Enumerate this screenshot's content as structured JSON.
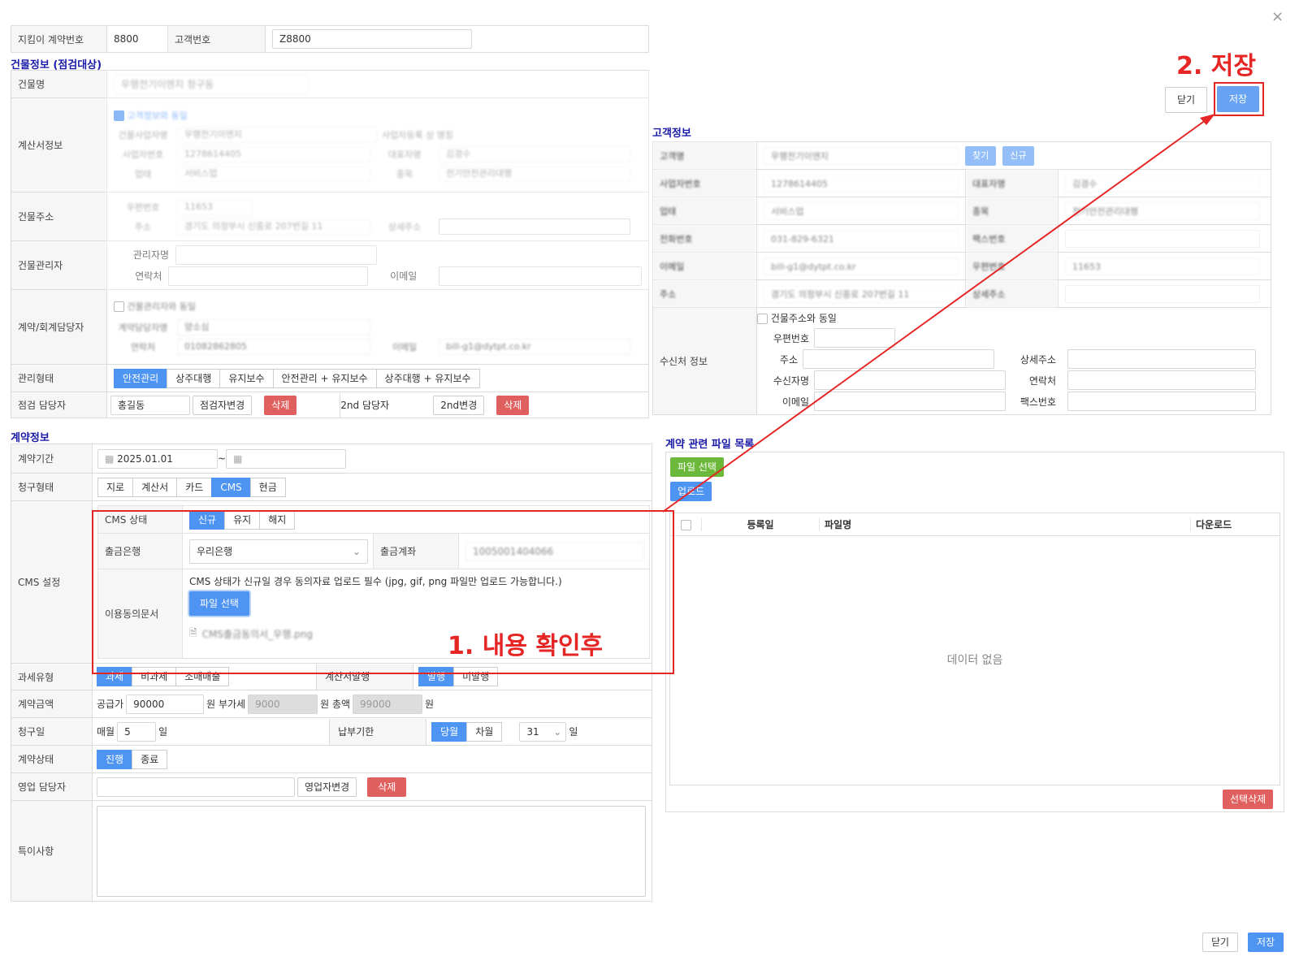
{
  "close_icon": "×",
  "contract_top": {
    "label1": "지킴이 계약번호",
    "value1": "8800",
    "label2": "고객번호",
    "value2": "Z8800"
  },
  "building_section": {
    "title": "건물정보 (점검대상)",
    "name_label": "건물명",
    "name_value": "우행전기이엔지 청구동",
    "invoice_label": "계산서정보",
    "same_as_customer": "고객정보와 동일",
    "biz_name_label": "건물사업자명",
    "biz_name_value": "우행전기이엔지",
    "biz_reg_label": "사업자등록 상 명칭",
    "biz_no_label": "사업자번호",
    "biz_no_value": "1278614405",
    "ceo_label": "대표자명",
    "ceo_value": "김경수",
    "industry_label": "업태",
    "industry_value": "서비스업",
    "item_label": "종목",
    "item_value": "전기안전관리대행",
    "address_label": "건물주소",
    "zip_label": "우편번호",
    "zip_value": "11653",
    "addr_label": "주소",
    "addr_value": "경기도 의정부시 신흥로 207번길 11",
    "detail_label": "상세주소",
    "manager_label": "건물관리자",
    "manager_name_label": "관리자명",
    "manager_phone_label": "연락처",
    "manager_email_label": "이메일",
    "acct_label": "계약/회계담당자",
    "acct_same": "건물관리자와 동일",
    "acct_name_label": "계약담당자명",
    "acct_name_value": "양소심",
    "acct_phone_label": "연락처",
    "acct_phone_value": "01082862805",
    "acct_email_label": "이메일",
    "acct_email_value": "bill-g1@dytpt.co.kr",
    "mgmt_type_label": "관리형태",
    "mgmt_types": [
      "안전관리",
      "상주대행",
      "유지보수",
      "안전관리 + 유지보수",
      "상주대행 + 유지보수"
    ],
    "inspector_label": "점검 담당자",
    "inspector_value": "홍길동",
    "inspector_change": "점검자변경",
    "delete": "삭제",
    "second_label": "2nd 담당자",
    "second_change": "2nd변경"
  },
  "contract_section": {
    "title": "계약정보",
    "period_label": "계약기간",
    "period_start": "2025.01.01",
    "tilde": "~",
    "billing_label": "청구형태",
    "billing_types": [
      "지로",
      "계산서",
      "카드",
      "CMS",
      "현금"
    ],
    "cms_label": "CMS 설정",
    "cms_status_label": "CMS 상태",
    "cms_statuses": [
      "신규",
      "유지",
      "해지"
    ],
    "bank_label": "출금은행",
    "bank_value": "우리은행",
    "account_label": "출금계좌",
    "account_value": "1005001404066",
    "consent_label": "이용동의문서",
    "consent_notice": "CMS 상태가 신규일 경우 동의자료 업로드 필수 (jpg, gif, png 파일만 업로드 가능합니다.)",
    "file_select": "파일 선택",
    "file_name": "CMS출금동의서_우행.png",
    "tax_label": "과세유형",
    "tax_types": [
      "과세",
      "비과세",
      "소매매출"
    ],
    "invoice_issue_label": "계산서발행",
    "invoice_issue": [
      "발행",
      "미발행"
    ],
    "amount_label": "계약금액",
    "supply_label": "공급가",
    "supply_value": "90000",
    "won1": "원 부가세",
    "vat_value": "9000",
    "won2": "원 총액",
    "total_value": "99000",
    "won3": "원",
    "bill_day_label": "청구일",
    "monthly": "매월",
    "bill_day_value": "5",
    "day": "일",
    "due_label": "납부기한",
    "due_types": [
      "당월",
      "차월"
    ],
    "due_day": "31",
    "day2": "일",
    "status_label": "계약상태",
    "statuses": [
      "진행",
      "종료"
    ],
    "sales_label": "영업 담당자",
    "sales_change": "영업자변경",
    "delete": "삭제",
    "note_label": "특이사항"
  },
  "customer_section": {
    "title": "고객정보",
    "rows": [
      {
        "l1": "고객명",
        "v1": "우행전기이엔지",
        "l2": "",
        "v2": ""
      },
      {
        "l1": "사업자번호",
        "v1": "1278614405",
        "l2": "대표자명",
        "v2": "김경수"
      },
      {
        "l1": "업태",
        "v1": "서비스업",
        "l2": "종목",
        "v2": "전기안전관리대행"
      },
      {
        "l1": "전화번호",
        "v1": "031-829-6321",
        "l2": "팩스번호",
        "v2": ""
      },
      {
        "l1": "이메일",
        "v1": "bill-g1@dytpt.co.kr",
        "l2": "우편번호",
        "v2": "11653"
      },
      {
        "l1": "주소",
        "v1": "경기도 의정부시 신흥로 207번길 11",
        "l2": "상세주소",
        "v2": ""
      }
    ],
    "btn_search": "찾기",
    "btn_new": "신규",
    "recv_label": "수신처 정보",
    "recv_same": "건물주소와 동일",
    "recv_zip": "우편번호",
    "recv_addr": "주소",
    "recv_detail": "상세주소",
    "recv_name": "수신자명",
    "recv_phone": "연락처",
    "recv_email": "이메일",
    "recv_fax": "팩스번호"
  },
  "file_section": {
    "title": "계약 관련 파일 목록",
    "file_select": "파일 선택",
    "upload": "업로드",
    "col_date": "등록일",
    "col_name": "파일명",
    "col_download": "다운로드",
    "empty": "데이터 없음",
    "delete_selected": "선택삭제"
  },
  "top_buttons": {
    "close": "닫기",
    "save": "저장"
  },
  "bottom_buttons": {
    "close": "닫기",
    "save": "저장"
  },
  "annotations": {
    "step1": "1. 내용 확인후",
    "step2": "2. 저장"
  },
  "colors": {
    "accent": "#4e94f2",
    "annotation": "#e62525",
    "section_title": "#1a1aa8"
  }
}
